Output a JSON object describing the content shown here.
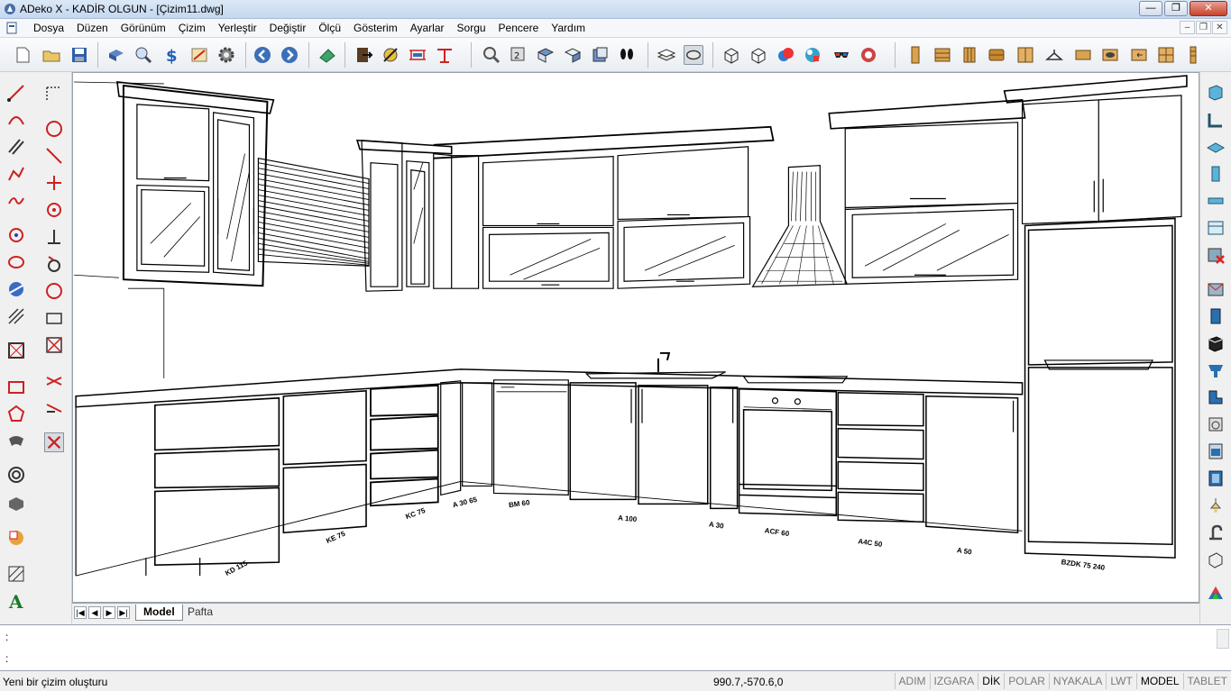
{
  "window": {
    "title": "ADeko X - KADİR OLGUN - [Çizim11.dwg]",
    "min": "—",
    "max": "❐",
    "close": "✕"
  },
  "menubar": {
    "items": [
      "Dosya",
      "Düzen",
      "Görünüm",
      "Çizim",
      "Yerleştir",
      "Değiştir",
      "Ölçü",
      "Gösterim",
      "Ayarlar",
      "Sorgu",
      "Pencere",
      "Yardım"
    ]
  },
  "mdi": {
    "min": "–",
    "restore": "❐",
    "close": "✕"
  },
  "tabs": {
    "nav": [
      "|◀",
      "◀",
      "▶",
      "▶|"
    ],
    "items": [
      "Model",
      "Pafta"
    ],
    "active": "Model"
  },
  "command": {
    "line1": ":",
    "line2": ":"
  },
  "status": {
    "message": "Yeni bir çizim oluşturu",
    "coords": "990.7,-570.6,0",
    "toggles": [
      {
        "label": "ADIM",
        "on": false
      },
      {
        "label": "IZGARA",
        "on": false
      },
      {
        "label": "DİK",
        "on": true
      },
      {
        "label": "POLAR",
        "on": false
      },
      {
        "label": "NYAKALA",
        "on": false
      },
      {
        "label": "LWT",
        "on": false
      },
      {
        "label": "MODEL",
        "on": true
      },
      {
        "label": "TABLET",
        "on": false
      }
    ]
  },
  "drawing": {
    "labels": [
      {
        "text": "KD 115"
      },
      {
        "text": "KE 75"
      },
      {
        "text": "KC 75"
      },
      {
        "text": "A 30 65"
      },
      {
        "text": "BM 60"
      },
      {
        "text": "A 100"
      },
      {
        "text": "A 30"
      },
      {
        "text": "ACF 60"
      },
      {
        "text": "A4C 50"
      },
      {
        "text": "A 50"
      },
      {
        "text": "BZDK 75 240"
      }
    ]
  }
}
